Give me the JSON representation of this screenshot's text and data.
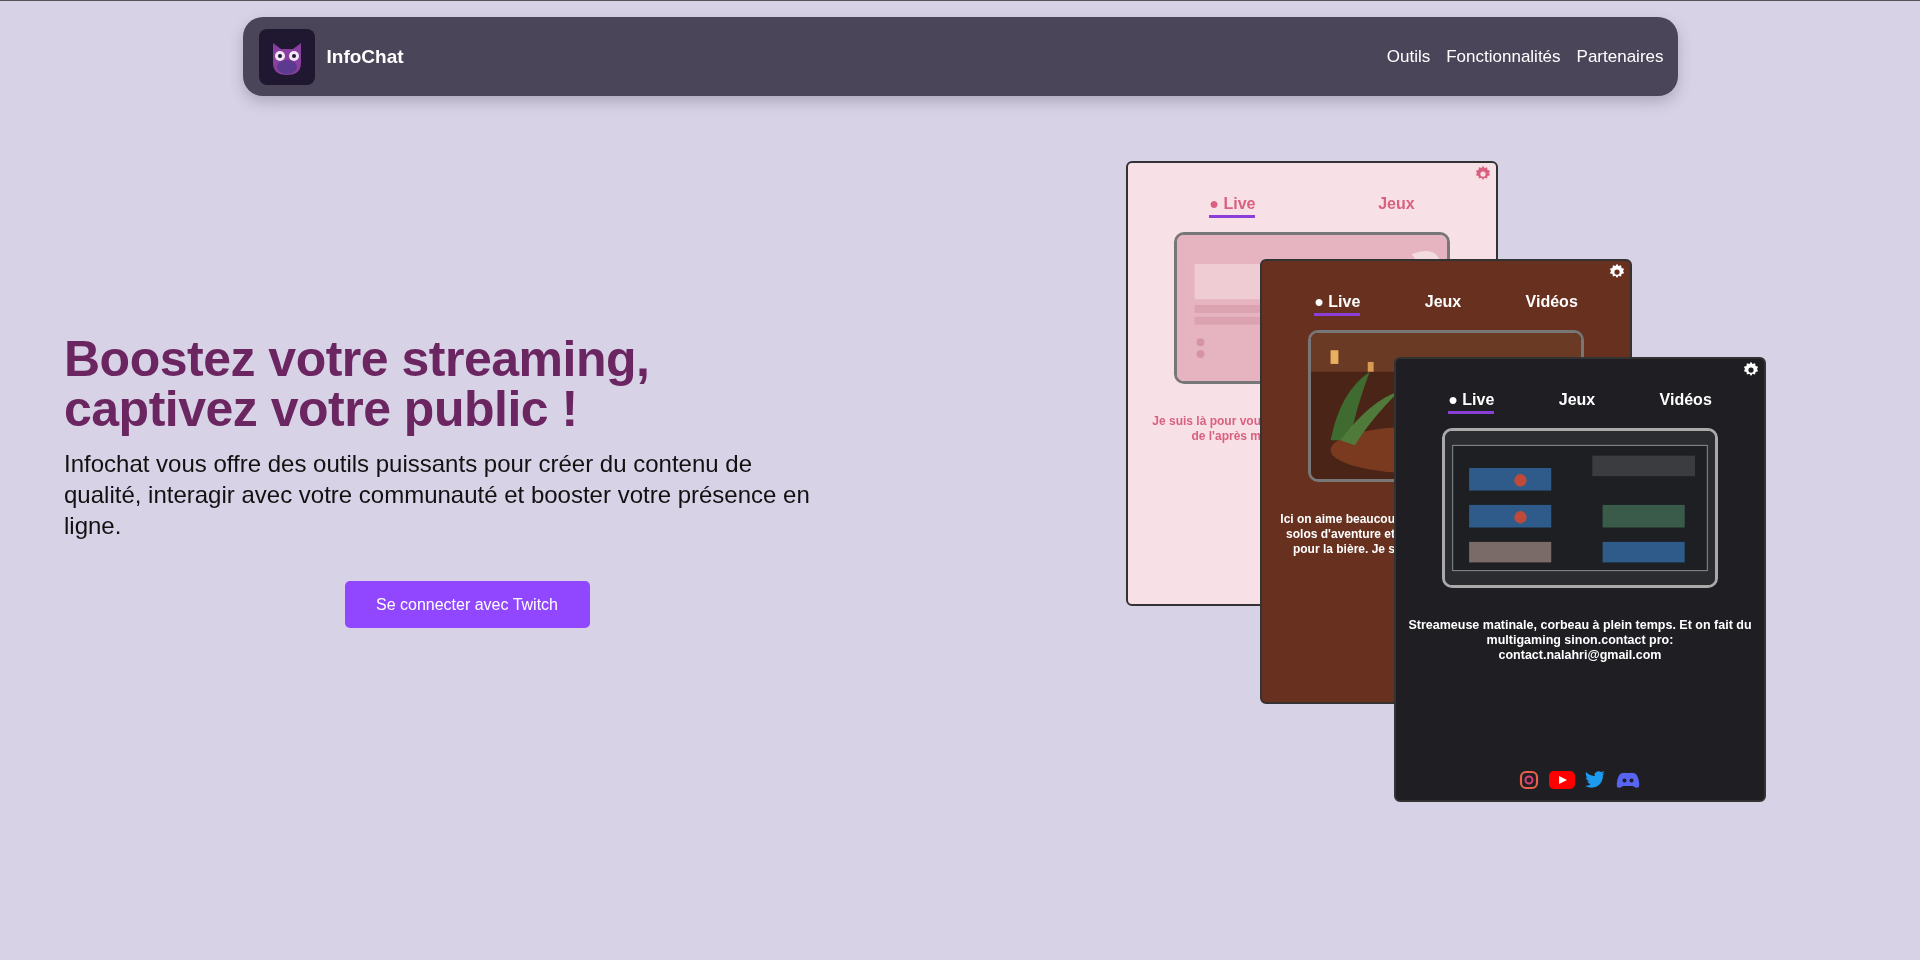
{
  "nav": {
    "brand": "InfoChat",
    "links": [
      "Outils",
      "Fonctionnalités",
      "Partenaires"
    ]
  },
  "hero": {
    "title": "Boostez votre streaming, captivez votre public !",
    "text": "Infochat vous offre des outils puissants pour créer du contenu de qualité, interagir avec votre communauté et booster votre présence en ligne.",
    "button": "Se connecter avec Twitch"
  },
  "cards": [
    {
      "kind": "pink",
      "tabs": [
        {
          "label": "● Live",
          "selected": true
        },
        {
          "label": "Jeux",
          "selected": false
        }
      ],
      "description": [
        "Je suis là pour vou",
        "de l'après m"
      ]
    },
    {
      "kind": "brown",
      "tabs": [
        {
          "label": "● Live",
          "selected": true
        },
        {
          "label": "Jeux",
          "selected": false
        },
        {
          "label": "Vidéos",
          "selected": false
        }
      ],
      "description": [
        "Ici on aime beaucou",
        "solos d'aventure et",
        "pour la bière. Je s"
      ]
    },
    {
      "kind": "dark",
      "tabs": [
        {
          "label": "● Live",
          "selected": true
        },
        {
          "label": "Jeux",
          "selected": false
        },
        {
          "label": "Vidéos",
          "selected": false
        }
      ],
      "description": [
        "Streameuse matinale, corbeau à plein temps. Et on fait du multigaming sinon.contact pro: contact.nalahri@gmail.com"
      ]
    }
  ]
}
